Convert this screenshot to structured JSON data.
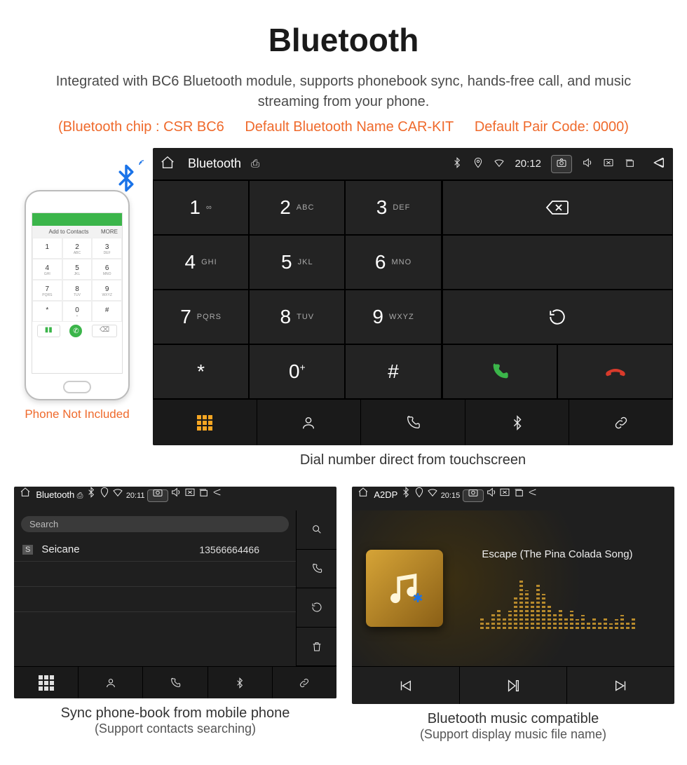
{
  "page": {
    "title": "Bluetooth",
    "subtitle": "Integrated with BC6 Bluetooth module, supports phonebook sync, hands-free call, and music streaming from your phone.",
    "spec_chip": "(Bluetooth chip : CSR BC6",
    "spec_name": "Default Bluetooth Name CAR-KIT",
    "spec_code": "Default Pair Code: 0000)"
  },
  "phone": {
    "note": "Phone Not Included",
    "contacts_label": "Add to Contacts",
    "more_label": "MORE"
  },
  "main_screen": {
    "app_title": "Bluetooth",
    "clock": "20:12",
    "keys": [
      {
        "n": "1",
        "s": "∞"
      },
      {
        "n": "2",
        "s": "ABC"
      },
      {
        "n": "3",
        "s": "DEF"
      },
      {
        "n": "4",
        "s": "GHI"
      },
      {
        "n": "5",
        "s": "JKL"
      },
      {
        "n": "6",
        "s": "MNO"
      },
      {
        "n": "7",
        "s": "PQRS"
      },
      {
        "n": "8",
        "s": "TUV"
      },
      {
        "n": "9",
        "s": "WXYZ"
      },
      {
        "n": "*",
        "s": ""
      },
      {
        "n": "0",
        "s": "+",
        "sup": true
      },
      {
        "n": "#",
        "s": ""
      }
    ],
    "caption": "Dial number direct from touchscreen"
  },
  "contacts_screen": {
    "app_title": "Bluetooth",
    "clock": "20:11",
    "search_placeholder": "Search",
    "contact_badge": "S",
    "contact_name": "Seicane",
    "contact_number": "13566664466",
    "caption_line1": "Sync phone-book from mobile phone",
    "caption_line2": "(Support contacts searching)"
  },
  "music_screen": {
    "app_title": "A2DP",
    "clock": "20:15",
    "track_title": "Escape (The Pina Colada Song)",
    "caption_line1": "Bluetooth music compatible",
    "caption_line2": "(Support display music file name)"
  }
}
